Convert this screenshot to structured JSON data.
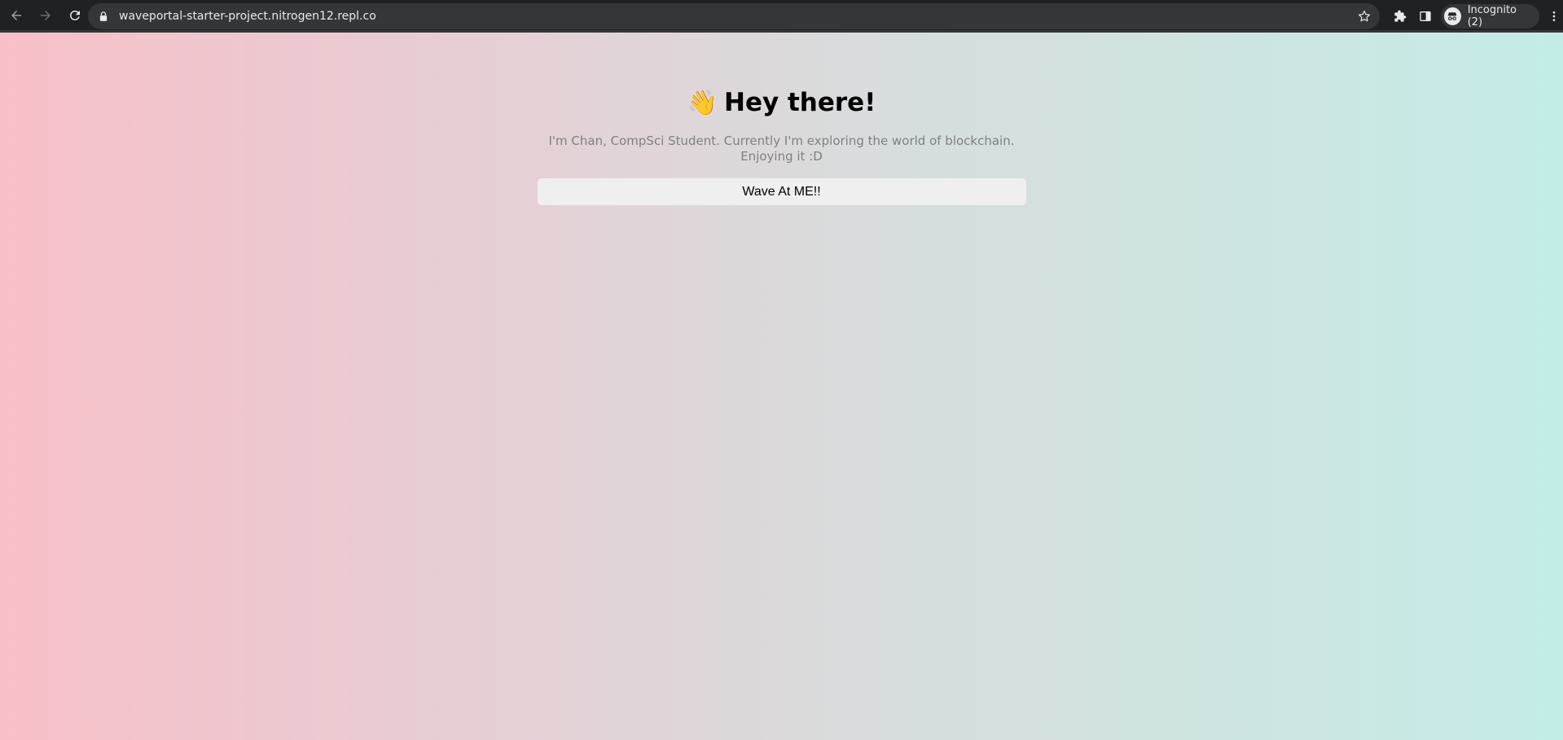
{
  "browser": {
    "url": "waveportal-starter-project.nitrogen12.repl.co",
    "profile_label": "Incognito (2)",
    "icons": {
      "back": "arrow-left-icon",
      "forward": "arrow-right-icon",
      "reload": "reload-icon",
      "lock": "lock-icon",
      "bookmark": "star-icon",
      "extensions": "puzzle-icon",
      "side_panel": "side-panel-icon",
      "profile": "incognito-icon",
      "menu": "kebab-menu-icon"
    }
  },
  "page": {
    "emoji": "👋",
    "heading": "Hey there!",
    "bio": "I'm Chan, CompSci Student. Currently I'm exploring the world of blockchain. Enjoying it :D",
    "button_label": "Wave At ME!!"
  },
  "colors": {
    "gradient_left": "#f8bfc8",
    "gradient_right": "#c4ece7",
    "button_bg": "#efefef",
    "bio_text": "#808080",
    "browser_bar": "#202124"
  }
}
